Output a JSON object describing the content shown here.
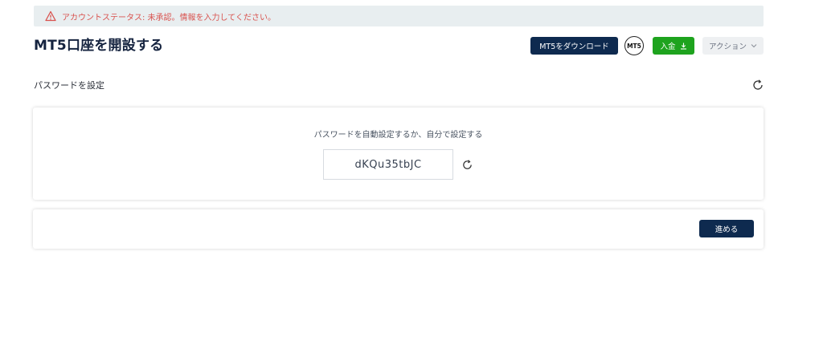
{
  "alert": {
    "text": "アカウントステータス: 未承認。情報を入力してください。",
    "icon": "warning-icon",
    "color": "#d9534f"
  },
  "header": {
    "title": "MT5口座を開設する",
    "download_label": "MT5をダウンロード",
    "badge_label": "MT5",
    "deposit_label": "入金",
    "deposit_icon": "download-icon",
    "action_label": "アクション",
    "action_icon": "chevron-down-icon"
  },
  "section": {
    "label": "パスワードを設定",
    "refresh_icon": "refresh-icon"
  },
  "password_card": {
    "instruction": "パスワードを自動設定するか、自分で設定する",
    "password_value": "dKQu35tbJC",
    "refresh_icon": "refresh-icon"
  },
  "footer": {
    "next_label": "進める"
  },
  "colors": {
    "primary": "#0e2a4f",
    "deposit": "#1ea31e",
    "alert_bg": "#e8eef0",
    "alert_text": "#d9534f"
  }
}
